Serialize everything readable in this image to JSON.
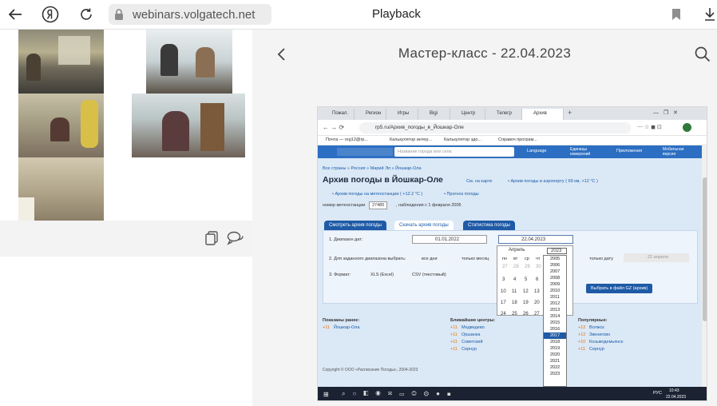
{
  "browser": {
    "url": "webinars.volgatech.net",
    "title": "Playback"
  },
  "player": {
    "title": "Мастер-класс - 22.04.2023"
  },
  "shared_screen": {
    "tabs": [
      "Пожал.",
      "Регион",
      "Игры",
      "Bigi",
      "Центр",
      "Телегр",
      "Архив"
    ],
    "address": "rp5.ru/Архив_погоды_в_Йошкар-Оле",
    "bookmarks": [
      "Почта — reg12@rp...",
      "Калькулятор интер...",
      "Калькулятор здо...",
      "Справоч програм..."
    ],
    "site": {
      "search_placeholder": "Название города или села",
      "language": "Language",
      "units": "Единицы измерений",
      "apps": "Приложения",
      "mobile": "Мобильная версия",
      "breadcrumb": "Все страны » Россия » Марий Эл » Йошкар-Ола",
      "heading": "Архив погоды в Йошкар-Оле",
      "map_link": "См. на карте",
      "airport_link": "• Архив погоды в аэропорту ( 69 км, +12 °C )",
      "station_link": "• Архив погоды на метеостанции ( +12.2 °C )",
      "forecast_link": "• Прогноз погоды",
      "station_label": "номер метеостанции",
      "station_number": "27485",
      "observations": ", наблюдения с 1 февраля 2005",
      "tab_view": "Смотреть архив погоды",
      "tab_download": "Скачать архив погоды",
      "tab_stats": "Статистика погоды",
      "range_label": "1.  Диапазон дат:",
      "date_from": "01.01.2022",
      "date_to": "22.04.2023",
      "choose_label": "2.  Для заданного диапазона выбрать:",
      "opt_all": "все дни",
      "opt_month": "только месяц",
      "opt_date": "только дату",
      "date_select": "22 апреля",
      "format_label": "3.  Формат:",
      "fmt_xls": "XLS (Excel)",
      "fmt_csv": "CSV (текстовый)",
      "download_btn": "Выбрать в файл GZ (архив)",
      "month": "Апрель",
      "year": "2023",
      "weekdays": [
        "пн",
        "вт",
        "ср",
        "чт"
      ],
      "cal_rows": [
        [
          "27",
          "28",
          "29",
          "30"
        ],
        [
          "",
          "",
          "",
          ""
        ],
        [
          "3",
          "4",
          "5",
          "6"
        ],
        [
          "10",
          "11",
          "12",
          "13"
        ],
        [
          "17",
          "18",
          "19",
          "20"
        ],
        [
          "24",
          "25",
          "26",
          "27"
        ]
      ],
      "years": [
        "2005",
        "2006",
        "2007",
        "2008",
        "2009",
        "2010",
        "2011",
        "2012",
        "2013",
        "2014",
        "2015",
        "2016",
        "2017",
        "2018",
        "2019",
        "2020",
        "2021",
        "2022",
        "2023"
      ],
      "selected_year": "2017",
      "shown_title": "Показаны ранее:",
      "shown": [
        {
          "t": "+11",
          "c": "Йошкар-Ола"
        }
      ],
      "near_title": "Ближайшие центры:",
      "near": [
        {
          "t": "+11",
          "c": "Медведево"
        },
        {
          "t": "+11",
          "c": "Оршанка"
        },
        {
          "t": "+11",
          "c": "Советский"
        },
        {
          "t": "+11",
          "c": "Сернур"
        }
      ],
      "popular_title": "Популярные:",
      "popular": [
        {
          "t": "+12",
          "c": "Волжск"
        },
        {
          "t": "+12",
          "c": "Звенигово"
        },
        {
          "t": "+10",
          "c": "Козьмодемьянск"
        },
        {
          "t": "+11",
          "c": "Сернур"
        }
      ],
      "copyright": "Copyright © ООО «Расписание Погоды», 2004-2023"
    },
    "taskbar": {
      "lang": "РУС",
      "time": "10:43",
      "date": "22.04.2023"
    }
  }
}
